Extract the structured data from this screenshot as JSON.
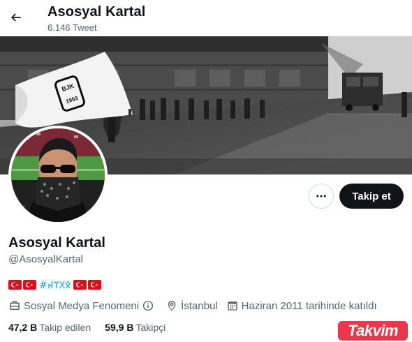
{
  "header": {
    "title": "Asosyal Kartal",
    "post_count": "6.146 Tweet"
  },
  "profile": {
    "display_name": "Asosyal Kartal",
    "handle": "@AsosyalKartal",
    "bio_hashtag": "#𐰋𐰓𐰼𐰴",
    "category": "Sosyal Medya Fenomeni",
    "location": "İstanbul",
    "joined": "Haziran 2011 tarihinde katıldı",
    "following_count": "47,2 B",
    "following_label": "Takip edilen",
    "followers_count": "59,9 B",
    "followers_label": "Takipçi"
  },
  "actions": {
    "follow_label": "Takip et"
  },
  "banner": {
    "flag_text": "BJK",
    "flag_year": "1903"
  },
  "watermark": {
    "text": "Takvim"
  },
  "colors": {
    "text_primary": "#0f1419",
    "text_secondary": "#536471",
    "link": "#1d9bf0",
    "follow_bg": "#0f1419",
    "turkish_red": "#e30a17",
    "watermark_red": "#e8273c"
  }
}
